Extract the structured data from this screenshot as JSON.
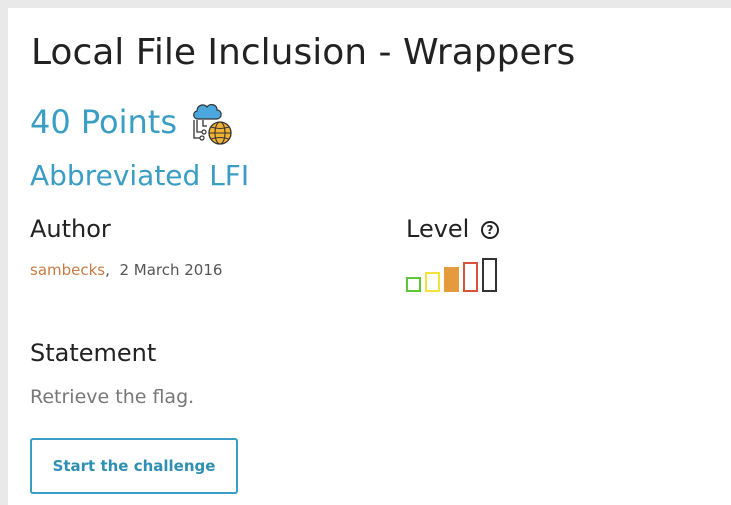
{
  "challenge": {
    "title": "Local File Inclusion - Wrappers",
    "points": "40 Points",
    "category_icon": "cloud-network-globe-icon",
    "subtitle": "Abbreviated LFI"
  },
  "author_section": {
    "label": "Author",
    "author_name": "sambecks",
    "separator": ",",
    "date": "2 March 2016"
  },
  "level_section": {
    "label": "Level",
    "help_glyph": "?",
    "level": 3,
    "max_level": 5,
    "bar_colors": [
      "#5cc639",
      "#f2e33b",
      "#e59a3e",
      "#d9533c",
      "#333333"
    ]
  },
  "statement_section": {
    "label": "Statement",
    "text": "Retrieve the flag."
  },
  "actions": {
    "start_label": "Start the challenge"
  },
  "colors": {
    "accent": "#3a9ec4",
    "author_link": "#c87c43"
  }
}
